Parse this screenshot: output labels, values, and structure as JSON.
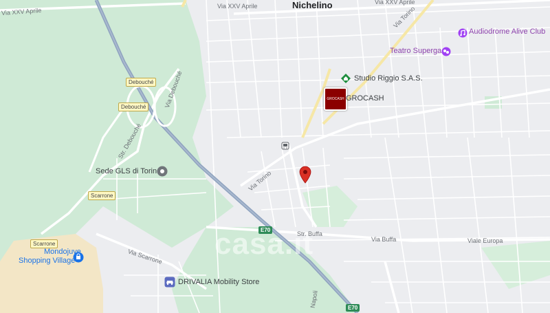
{
  "map": {
    "town": "Nichelino",
    "streets": {
      "via_xxv_aprile_left": "Via XXV Aprile",
      "via_xxv_aprile_top": "Via XXV Aprile",
      "via_xxv_aprile_right": "Via XXV Aprile",
      "via_torino_top": "Via Torino",
      "via_debouche": "Via Debouché",
      "str_debouche": "Str. Debouché",
      "via_torino": "Via Torino",
      "str_buffa": "Str. Buffa",
      "via_buffa": "Via Buffa",
      "viale_europa": "Viale Europa",
      "via_scarrone": "Via Scarrone",
      "via_napoli": "Napoli"
    },
    "shields": {
      "debouche_1": "Debouché",
      "debouche_2": "Debouché",
      "scarrone_1": "Scarrone",
      "scarrone_2": "Scarrone",
      "e70_1": "E70",
      "e70_2": "E70"
    },
    "pois": {
      "audiodrome": "Audiodrome Alive Club",
      "teatro": "Teatro Superga",
      "studio_riggio": "Studio Riggio S.A.S.",
      "grocash": "GROCASH",
      "grocash_logo": "GROCASH",
      "sede_gls": "Sede GLS di Torino",
      "mondojuve_line1": "Mondojuve",
      "mondojuve_line2": "Shopping Village",
      "drivalia": "DRIVALIA Mobility Store"
    },
    "watermark": "casa.it",
    "colors": {
      "background": "#ecedf0",
      "green_area": "#cfead6",
      "highway": "#8fa3bf",
      "road": "#ffffff",
      "yellow_road": "#f6e7a6",
      "mall_area": "#f3e6c6",
      "pin": "#d93025",
      "purple_poi": "#a142f4",
      "teal_poi": "#1e8e3e",
      "grocash_red": "#8b0000"
    },
    "icons": [
      "map-pin-icon",
      "music-icon",
      "theater-icon",
      "business-icon",
      "transit-icon",
      "location-icon",
      "shopping-icon",
      "car-icon"
    ]
  }
}
